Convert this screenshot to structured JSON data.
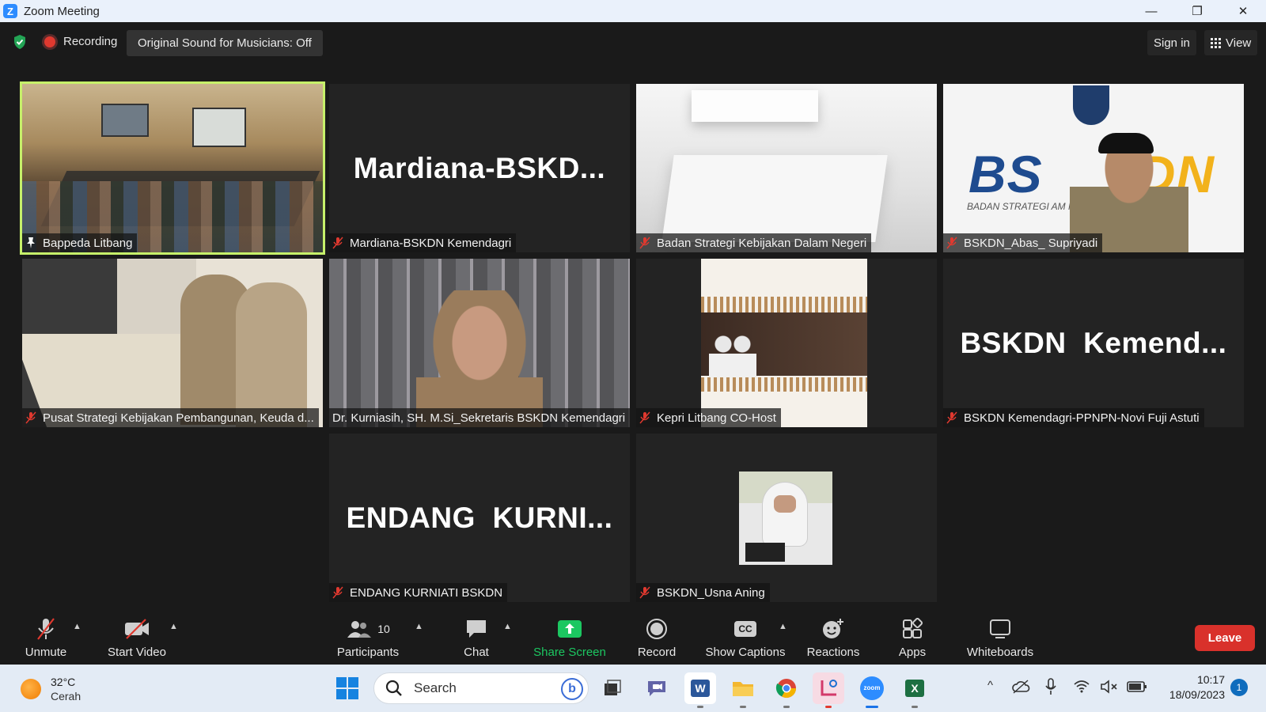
{
  "window": {
    "title": "Zoom Meeting",
    "controls": {
      "minimize": "—",
      "restore": "❐",
      "close": "✕"
    }
  },
  "topbar": {
    "recording": "Recording",
    "original_sound": "Original Sound for Musicians: Off",
    "sign_in": "Sign in",
    "view": "View"
  },
  "tiles": [
    {
      "name": "Bappeda Litbang",
      "active": true,
      "big": ""
    },
    {
      "name": "Mardiana-BSKDN Kemendagri",
      "active": false,
      "big": "Mardiana-BSKD..."
    },
    {
      "name": "Badan Strategi Kebijakan Dalam Negeri",
      "active": false,
      "big": ""
    },
    {
      "name": "BSKDN_Abas_ Supriyadi",
      "active": false,
      "big": ""
    },
    {
      "name": "Pusat Strategi Kebijakan Pembangunan, Keuda d...",
      "active": false,
      "big": ""
    },
    {
      "name": "Dr. Kurniasih, SH. M.Si_Sekretaris BSKDN Kemendagri",
      "active": false,
      "big": ""
    },
    {
      "name": "Kepri Litbang CO-Host",
      "active": false,
      "big": ""
    },
    {
      "name": "BSKDN Kemendagri-PPNPN-Novi Fuji Astuti",
      "active": false,
      "big": "BSKDN  Kemend..."
    },
    {
      "name": "ENDANG KURNIATI BSKDN",
      "active": false,
      "big": "ENDANG  KURNI..."
    },
    {
      "name": "BSKDN_Usna Aning",
      "active": false,
      "big": ""
    }
  ],
  "bskdn_logo": {
    "left": "BS",
    "right": "DN",
    "sub": "BADAN STRATEGI          AM NEGERI"
  },
  "toolbar": {
    "unmute": "Unmute",
    "start_video": "Start Video",
    "participants": "Participants",
    "participants_count": "10",
    "chat": "Chat",
    "share_screen": "Share Screen",
    "record": "Record",
    "show_captions": "Show Captions",
    "cc": "CC",
    "reactions": "Reactions",
    "apps": "Apps",
    "whiteboards": "Whiteboards",
    "leave": "Leave"
  },
  "taskbar": {
    "temperature": "32°C",
    "weather": "Cerah",
    "search_placeholder": "Search",
    "time": "10:17",
    "date": "18/09/2023",
    "notifications": "1",
    "zoom_label": "zoom",
    "excel_label": "X",
    "word_label": "W"
  },
  "colors": {
    "accent_green": "#1cc761",
    "active_tile": "#c6f06a",
    "leave_red": "#d9312b",
    "zoom_blue": "#2d8cff"
  }
}
